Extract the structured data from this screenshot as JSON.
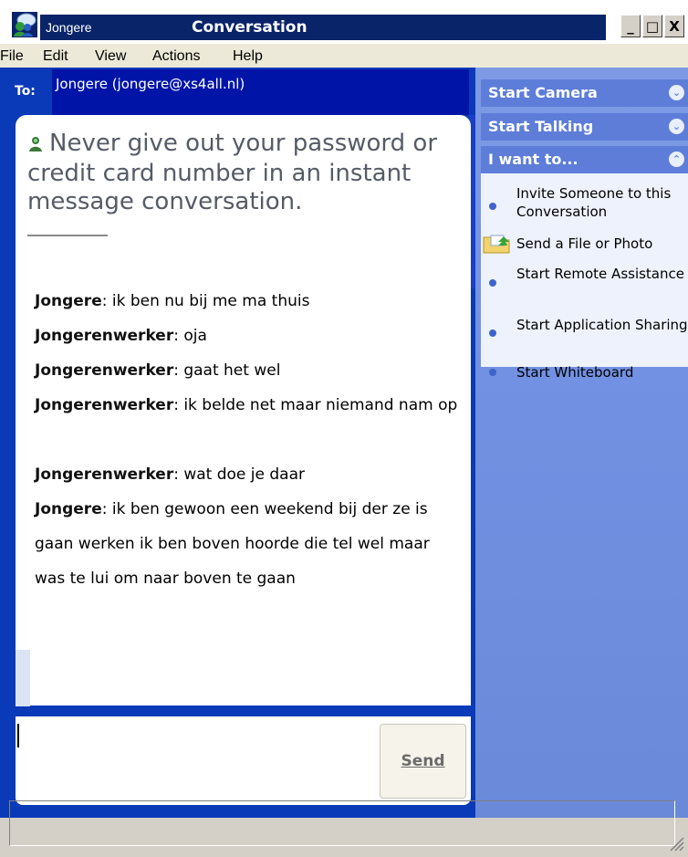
{
  "window": {
    "contact_name": "Jongere",
    "title": "Conversation",
    "minimize_glyph": "_",
    "maximize_glyph": "□",
    "close_glyph": "X"
  },
  "menu": [
    "File",
    "Edit",
    "View",
    "Actions",
    "Help"
  ],
  "to": {
    "label": "To:",
    "value": "Jongere (jongere@xs4all.nl)"
  },
  "warning": "Never give out your password or credit card number in an instant message conversation.",
  "messages": [
    {
      "sender": "Jongere",
      "text": ": ik ben nu bij me ma thuis"
    },
    {
      "sender": "Jongerenwerker",
      "text": ": oja"
    },
    {
      "sender": "Jongerenwerker",
      "text": ": gaat het wel"
    },
    {
      "sender": "Jongerenwerker",
      "text": ": ik belde net maar niemand nam op"
    },
    {
      "sender": "Jongerenwerker",
      "text": ": wat doe je daar"
    },
    {
      "sender": "Jongere",
      "text": ": ik ben gewoon een weekend bij der ze is gaan werken ik ben boven hoorde die tel wel maar was te lui om naar boven te gaan"
    }
  ],
  "compose": {
    "value": "",
    "send_label": "Send"
  },
  "task_pane": {
    "start_camera": "Start Camera",
    "start_talking": "Start Talking",
    "i_want_to": "I want to...",
    "items": [
      "Invite Someone to this Conversation",
      "Send a File or Photo",
      "Start Remote Assistance",
      "Start Application Sharing",
      "Start Whiteboard"
    ]
  },
  "colors": {
    "title_bar": "#0a246a",
    "conversation_frame": "#0b3ab8",
    "task_header": "#5d7dd8",
    "task_pane": "#7391e2"
  },
  "icons": [
    "messenger-buddy-icon",
    "warning-buddy-icon",
    "chevron-down-icon",
    "chevron-up-icon",
    "folder-photo-icon",
    "resize-grip-icon"
  ]
}
